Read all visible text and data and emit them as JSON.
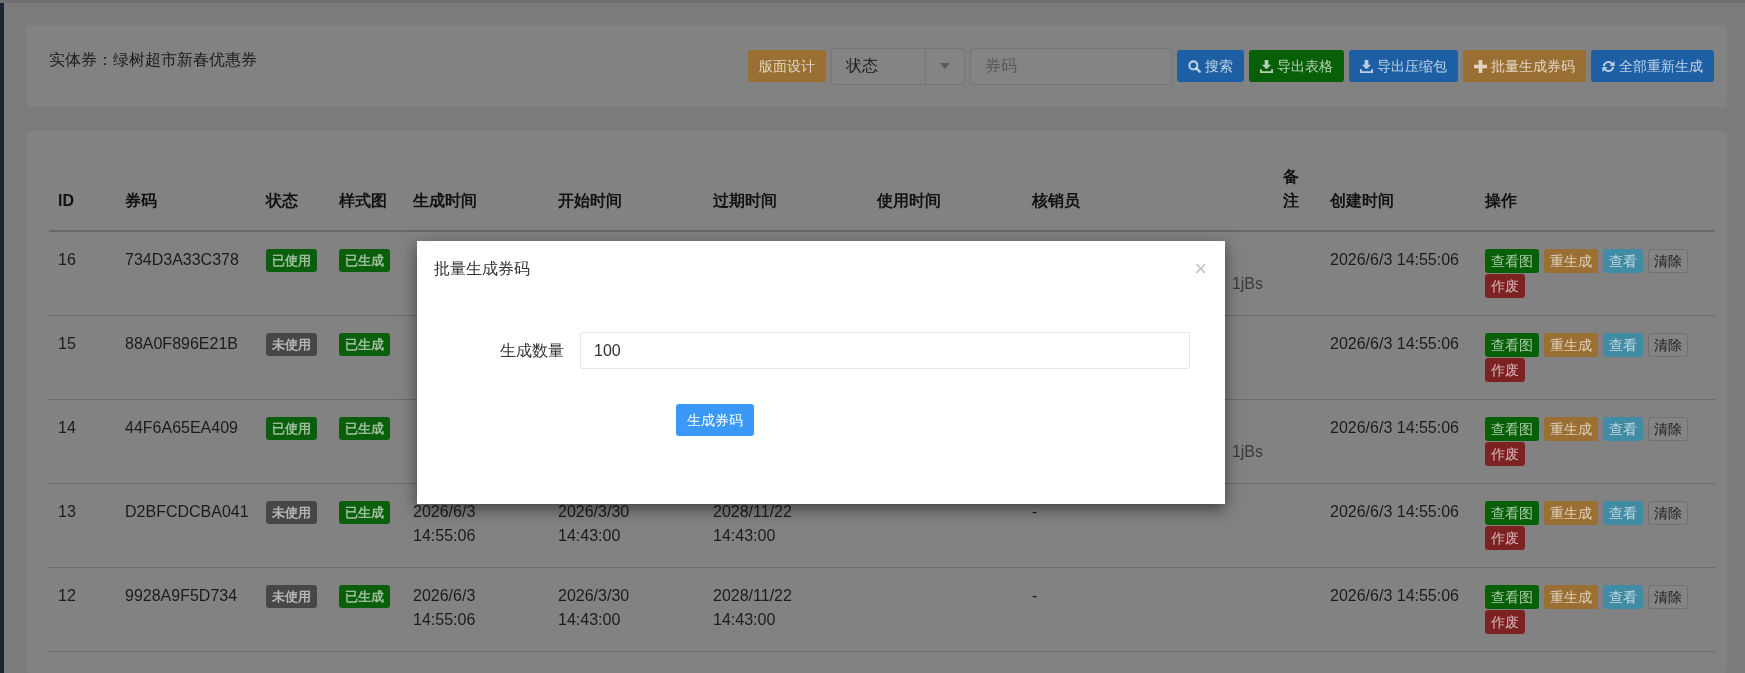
{
  "filter_panel": {
    "title": "实体券：绿树超市新春优惠券",
    "controls": [
      {
        "kind": "button",
        "label": "版面设计",
        "color": "#9a6f33"
      },
      {
        "kind": "select",
        "value": "状态"
      },
      {
        "kind": "input",
        "placeholder": "券码"
      },
      {
        "kind": "search",
        "label": "搜索",
        "color": "#1d5fa4"
      },
      {
        "kind": "download",
        "label": "导出表格",
        "color": "#075f07"
      },
      {
        "kind": "download",
        "label": "导出压缩包",
        "color": "#1d5fa4"
      },
      {
        "kind": "add",
        "label": "批量生成券码",
        "color": "#9a6f33"
      },
      {
        "kind": "refresh",
        "label": "全部重新生成",
        "color": "#1d5fa4"
      }
    ]
  },
  "table": {
    "columns": [
      "ID",
      "券码",
      "状态",
      "样式图",
      "生成时间",
      "开始时间",
      "过期时间",
      "使用时间",
      "核销员",
      "备注",
      "创建时间",
      "操作"
    ],
    "rows": [
      {
        "id": "16",
        "code": "734D3A33C378",
        "status": {
          "label": "已使用",
          "color": "#0b5e0b"
        },
        "image": {
          "label": "已生成",
          "color": "#0b5e0b"
        },
        "verifier": {
          "text": "1jBs",
          "partly_hidden": true
        },
        "created": "2026/6/3 14:55:06",
        "actions": [
          {
            "label": "查看图",
            "color": "#075f07"
          },
          {
            "label": "重生成",
            "color": "#9a6f33"
          },
          {
            "label": "查看",
            "color": "#428ba4"
          },
          {
            "label": "清除"
          },
          {
            "label": "作废",
            "color": "#7c2222"
          }
        ]
      },
      {
        "id": "15",
        "code": "88A0F896E21B",
        "status": {
          "label": "未使用",
          "color": "#474747"
        },
        "image": {
          "label": "已生成",
          "color": "#0b5e0b"
        },
        "created": "2026/6/3 14:55:06",
        "actions": [
          {
            "label": "查看图",
            "color": "#075f07"
          },
          {
            "label": "重生成",
            "color": "#9a6f33"
          },
          {
            "label": "查看",
            "color": "#428ba4"
          },
          {
            "label": "清除"
          },
          {
            "label": "作废",
            "color": "#7c2222"
          }
        ]
      },
      {
        "id": "14",
        "code": "44F6A65EA409",
        "status": {
          "label": "已使用",
          "color": "#0b5e0b"
        },
        "image": {
          "label": "已生成",
          "color": "#0b5e0b"
        },
        "verifier": {
          "text": "1jBs",
          "partly_hidden": true
        },
        "created": "2026/6/3 14:55:06",
        "actions": [
          {
            "label": "查看图",
            "color": "#075f07"
          },
          {
            "label": "重生成",
            "color": "#9a6f33"
          },
          {
            "label": "查看",
            "color": "#428ba4"
          },
          {
            "label": "清除"
          },
          {
            "label": "作废",
            "color": "#7c2222"
          }
        ]
      },
      {
        "id": "13",
        "code": "D2BFCDCBA041",
        "status": {
          "label": "未使用",
          "color": "#474747"
        },
        "image": {
          "label": "已生成",
          "color": "#0b5e0b"
        },
        "generated": "2026/6/3 14:55:06",
        "start": "2026/3/30 14:43:00",
        "expire": "2028/11/22 14:43:00",
        "verifier": {
          "text": "-",
          "partly_hidden": false
        },
        "created": "2026/6/3 14:55:06",
        "actions": [
          {
            "label": "查看图",
            "color": "#075f07"
          },
          {
            "label": "重生成",
            "color": "#9a6f33"
          },
          {
            "label": "查看",
            "color": "#428ba4"
          },
          {
            "label": "清除"
          },
          {
            "label": "作废",
            "color": "#7c2222"
          }
        ]
      },
      {
        "id": "12",
        "code": "9928A9F5D734",
        "status": {
          "label": "未使用",
          "color": "#474747"
        },
        "image": {
          "label": "已生成",
          "color": "#0b5e0b"
        },
        "generated": "2026/6/3 14:55:06",
        "start": "2026/3/30 14:43:00",
        "expire": "2028/11/22 14:43:00",
        "verifier": {
          "text": "-",
          "partly_hidden": false
        },
        "created": "2026/6/3 14:55:06",
        "actions": [
          {
            "label": "查看图",
            "color": "#075f07"
          },
          {
            "label": "重生成",
            "color": "#9a6f33"
          },
          {
            "label": "查看",
            "color": "#428ba4"
          },
          {
            "label": "清除"
          },
          {
            "label": "作废",
            "color": "#7c2222"
          }
        ]
      }
    ]
  },
  "dialog": {
    "title": "批量生成券码",
    "close": "×",
    "fields": [
      {
        "label": "生成数量",
        "value": "100"
      }
    ],
    "submit": "生成券码"
  }
}
